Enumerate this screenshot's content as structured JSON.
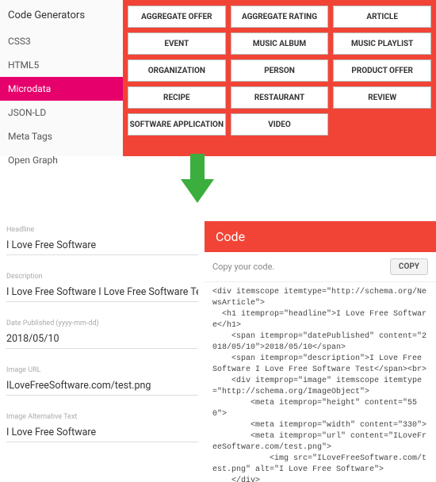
{
  "sidebar": {
    "title": "Code Generators",
    "items": [
      "CSS3",
      "HTML5",
      "Microdata",
      "JSON-LD",
      "Meta Tags",
      "Open Graph"
    ],
    "active": 2
  },
  "grid": [
    [
      "AGGREGATE OFFER",
      "AGGREGATE RATING",
      "ARTICLE"
    ],
    [
      "EVENT",
      "MUSIC ALBUM",
      "MUSIC PLAYLIST"
    ],
    [
      "ORGANIZATION",
      "PERSON",
      "PRODUCT OFFER"
    ],
    [
      "RECIPE",
      "RESTAURANT",
      "REVIEW"
    ],
    [
      "SOFTWARE APPLICATION",
      "VIDEO",
      ""
    ]
  ],
  "form": {
    "fields": [
      {
        "label": "Headline",
        "value": "I Love Free Software"
      },
      {
        "label": "Description",
        "value": "I Love Free Software I Love Free Software Test"
      },
      {
        "label": "Date Published (yyyy-mm-dd)",
        "value": "2018/05/10"
      },
      {
        "label": "Image URL",
        "value": "ILoveFreeSoftware.com/test.png"
      },
      {
        "label": "Image Alternative Text",
        "value": "I Love Free Software"
      }
    ]
  },
  "code": {
    "title": "Code",
    "toolbar_text": "Copy your code.",
    "copy_label": "COPY",
    "body": "<div itemscope itemtype=\"http://schema.org/NewsArticle\">\n  <h1 itemprop=\"headline\">I Love Free Software</h1>\n    <span itemprop=\"datePublished\" content=\"2018/05/10\">2018/05/10</span>\n    <span itemprop=\"description\">I Love Free Software I Love Free Software Test</span><br>\n    <div itemprop=\"image\" itemscope itemtype=\"http://schema.org/ImageObject\">\n        <meta itemprop=\"height\" content=\"550\">\n        <meta itemprop=\"width\" content=\"330\">\n        <meta itemprop=\"url\" content=\"ILoveFreeSoftware.com/test.png\">\n            <img src=\"ILoveFreeSoftware.com/test.png\" alt=\"I Love Free Software\">\n    </div>\n    Author: <span itemprop=\"author\">I Love Free Software</span><br>\n    <div itemprop=\"publisher\" itemscope itemtype=\"http://schema.org/Organization\">\n        <div itemprop=\"logo\" itemscope itemtype=\"http://schema.org/ImageObject\">\n            <meta itemprop=\"url\" content=\"undefined\">\n            <img src=\"undefined\" alt=\"undefined\">\n        </div>\n</div>"
  }
}
